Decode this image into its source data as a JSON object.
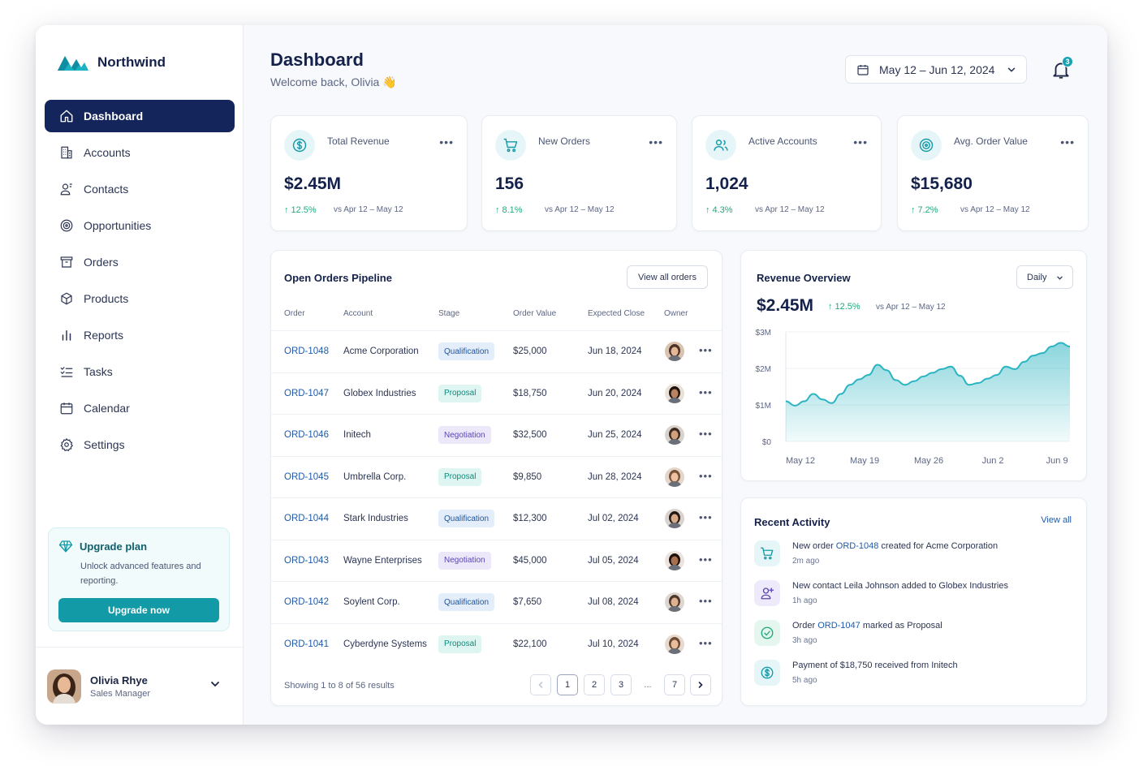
{
  "brand": {
    "name": "Northwind"
  },
  "nav": [
    {
      "label": "Dashboard",
      "icon": "home-icon",
      "active": true
    },
    {
      "label": "Accounts",
      "icon": "building-icon"
    },
    {
      "label": "Contacts",
      "icon": "user-icon"
    },
    {
      "label": "Opportunities",
      "icon": "target-icon"
    },
    {
      "label": "Orders",
      "icon": "archive-icon"
    },
    {
      "label": "Products",
      "icon": "box-icon"
    },
    {
      "label": "Reports",
      "icon": "bar-chart-icon"
    },
    {
      "label": "Tasks",
      "icon": "checklist-icon"
    },
    {
      "label": "Calendar",
      "icon": "calendar-icon"
    },
    {
      "label": "Settings",
      "icon": "gear-icon"
    }
  ],
  "upgrade": {
    "title": "Upgrade plan",
    "text": "Unlock advanced features and reporting.",
    "button": "Upgrade now"
  },
  "user": {
    "name": "Olivia Rhye",
    "role": "Sales Manager"
  },
  "header": {
    "title": "Dashboard",
    "subtitle": "Welcome back, Olivia 👋",
    "date_range": "May 12 – Jun 12, 2024",
    "notifications": "3"
  },
  "kpis": [
    {
      "label": "Total Revenue",
      "value": "$2.45M",
      "delta": "12.5%",
      "compare": "vs Apr 12 – May 12",
      "icon": "dollar-icon"
    },
    {
      "label": "New Orders",
      "value": "156",
      "delta": "8.1%",
      "compare": "vs Apr 12 – May 12",
      "icon": "cart-icon"
    },
    {
      "label": "Active Accounts",
      "value": "1,024",
      "delta": "4.3%",
      "compare": "vs Apr 12 – May 12",
      "icon": "users-icon"
    },
    {
      "label": "Avg. Order Value",
      "value": "$15,680",
      "delta": "7.2%",
      "compare": "vs Apr 12 – May 12",
      "icon": "target-icon"
    }
  ],
  "orders": {
    "title": "Open Orders Pipeline",
    "view_all": "View all orders",
    "columns": [
      "Order",
      "Account",
      "Stage",
      "Order Value",
      "Expected Close",
      "Owner"
    ],
    "rows": [
      {
        "id": "ORD-1048",
        "account": "Acme Corporation",
        "stage": "Qualification",
        "value": "$25,000",
        "close": "Jun 18, 2024"
      },
      {
        "id": "ORD-1047",
        "account": "Globex Industries",
        "stage": "Proposal",
        "value": "$18,750",
        "close": "Jun 20, 2024"
      },
      {
        "id": "ORD-1046",
        "account": "Initech",
        "stage": "Negotiation",
        "value": "$32,500",
        "close": "Jun 25, 2024"
      },
      {
        "id": "ORD-1045",
        "account": "Umbrella Corp.",
        "stage": "Proposal",
        "value": "$9,850",
        "close": "Jun 28, 2024"
      },
      {
        "id": "ORD-1044",
        "account": "Stark Industries",
        "stage": "Qualification",
        "value": "$12,300",
        "close": "Jul 02, 2024"
      },
      {
        "id": "ORD-1043",
        "account": "Wayne Enterprises",
        "stage": "Negotiation",
        "value": "$45,000",
        "close": "Jul 05, 2024"
      },
      {
        "id": "ORD-1042",
        "account": "Soylent Corp.",
        "stage": "Qualification",
        "value": "$7,650",
        "close": "Jul 08, 2024"
      },
      {
        "id": "ORD-1041",
        "account": "Cyberdyne Systems",
        "stage": "Proposal",
        "value": "$22,100",
        "close": "Jul 10, 2024"
      }
    ],
    "footer": "Showing 1 to 8 of 56 results",
    "pages": [
      "1",
      "2",
      "3",
      "...",
      "7"
    ]
  },
  "revenue": {
    "title": "Revenue Overview",
    "period": "Daily",
    "value": "$2.45M",
    "delta": "12.5%",
    "compare": "vs Apr 12 – May 12"
  },
  "chart_data": {
    "type": "area",
    "x": [
      "May 12",
      "May 13",
      "May 14",
      "May 15",
      "May 16",
      "May 17",
      "May 18",
      "May 19",
      "May 20",
      "May 21",
      "May 22",
      "May 23",
      "May 24",
      "May 25",
      "May 26",
      "May 27",
      "May 28",
      "May 29",
      "May 30",
      "May 31",
      "Jun 1",
      "Jun 2",
      "Jun 3",
      "Jun 4",
      "Jun 5",
      "Jun 6",
      "Jun 7",
      "Jun 8",
      "Jun 9",
      "Jun 10",
      "Jun 11",
      "Jun 12"
    ],
    "values": [
      1.1,
      0.98,
      1.1,
      1.3,
      1.15,
      1.05,
      1.3,
      1.55,
      1.7,
      1.82,
      2.1,
      1.95,
      1.68,
      1.55,
      1.65,
      1.78,
      1.88,
      1.98,
      2.05,
      1.8,
      1.55,
      1.6,
      1.72,
      1.82,
      2.05,
      1.98,
      2.18,
      2.35,
      2.42,
      2.6,
      2.7,
      2.6
    ],
    "yticks": [
      "$0",
      "$1M",
      "$2M",
      "$3M"
    ],
    "xticks": [
      "May 12",
      "May 19",
      "May 26",
      "Jun 2",
      "Jun 9"
    ],
    "ylim": [
      0,
      3
    ],
    "color": "#2bb4c1",
    "grid": true
  },
  "activity": {
    "title": "Recent Activity",
    "view_all": "View all",
    "items": [
      {
        "pre": "New order ",
        "link": "ORD-1048",
        "post": " created for Acme Corporation",
        "time": "2m ago",
        "icon": "cart-icon",
        "bg": "#e6f6f8",
        "fg": "#139aa7"
      },
      {
        "pre": "New contact Leila Johnson added to Globex Industries",
        "link": "",
        "post": "",
        "time": "1h ago",
        "icon": "user-plus-icon",
        "bg": "#eeeafb",
        "fg": "#5a47b3"
      },
      {
        "pre": "Order ",
        "link": "ORD-1047",
        "post": " marked as Proposal",
        "time": "3h ago",
        "icon": "check-circle-icon",
        "bg": "#e4f6ee",
        "fg": "#1fa97f"
      },
      {
        "pre": "Payment of $18,750 received from Initech",
        "link": "",
        "post": "",
        "time": "5h ago",
        "icon": "dollar-icon",
        "bg": "#e6f6f8",
        "fg": "#139aa7"
      }
    ]
  }
}
